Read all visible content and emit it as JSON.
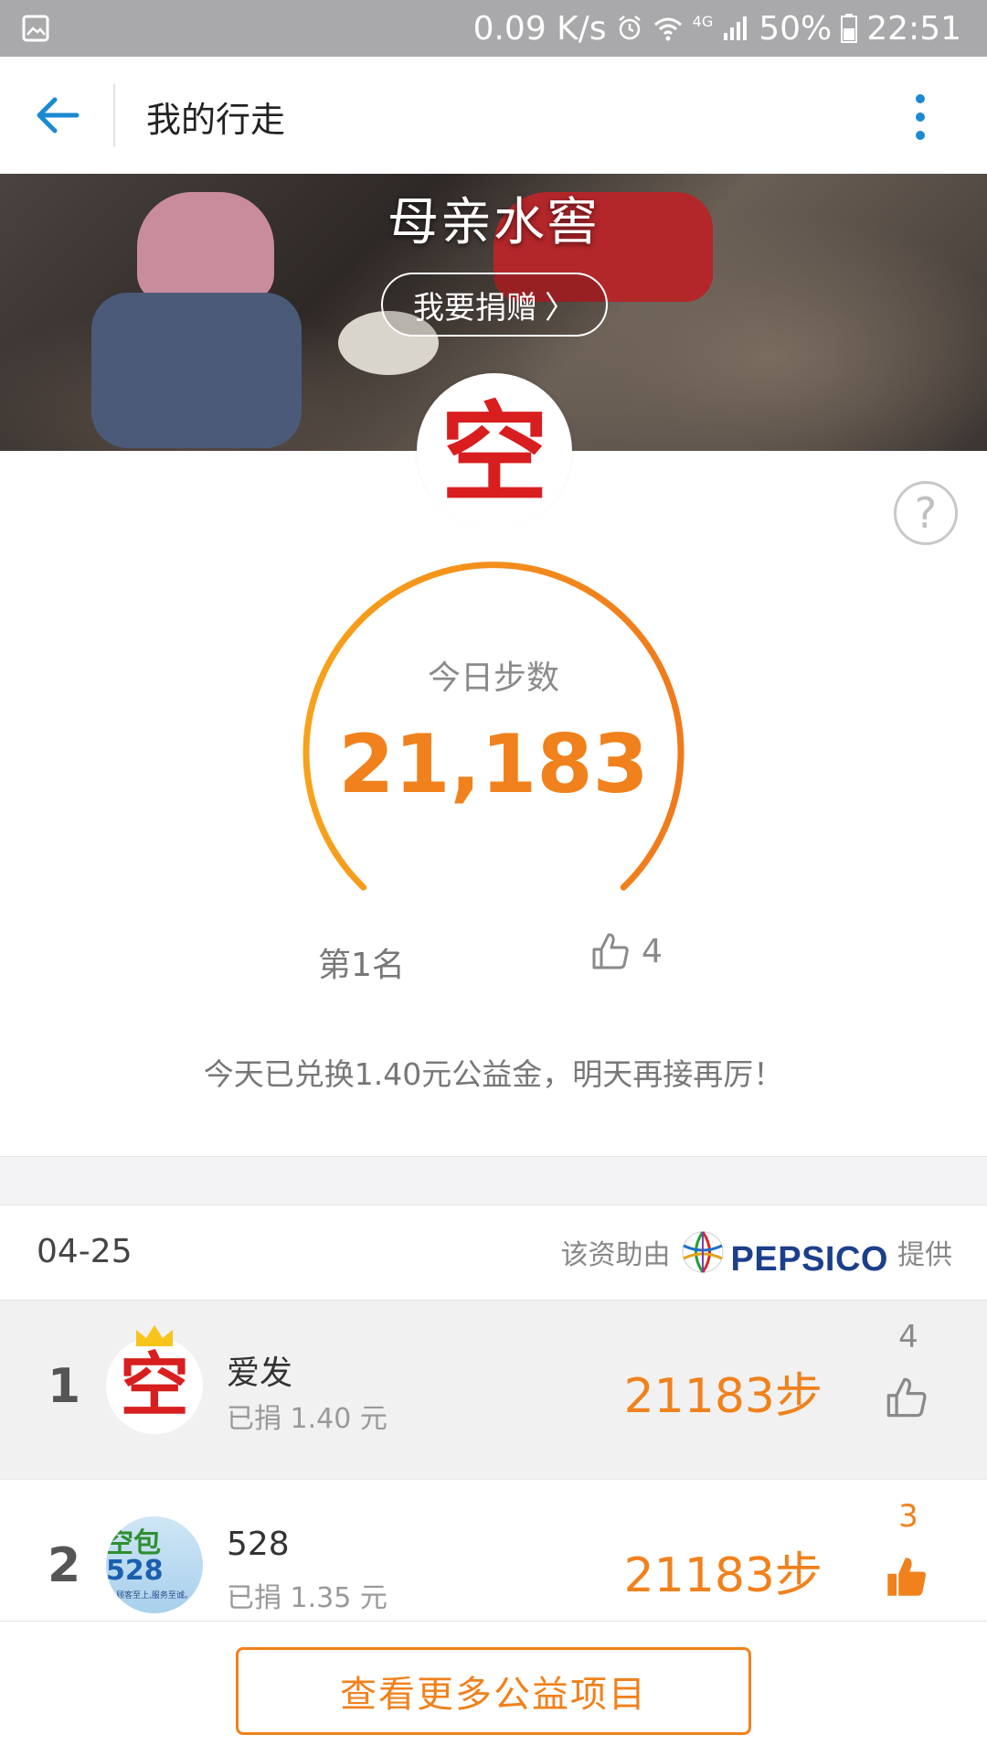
{
  "status_bar": {
    "speed": "0.09 K/s",
    "network_label": "4G",
    "battery": "50%",
    "time": "22:51"
  },
  "app_bar": {
    "title": "我的行走"
  },
  "banner": {
    "title": "母亲水窖",
    "donate_label": "我要捐赠",
    "donate_chevron": "〉"
  },
  "profile": {
    "avatar_char": "空",
    "help_label": "?"
  },
  "gauge": {
    "label": "今日步数",
    "steps": "21,183"
  },
  "stats": {
    "rank": "第1名",
    "likes": "4"
  },
  "note": "今天已兑换1.40元公益金，明天再接再厉！",
  "list_header": {
    "date": "04-25",
    "sponsor_prefix": "该资助由",
    "sponsor_brand": "PEPSICO",
    "sponsor_suffix": "提供"
  },
  "ranking": [
    {
      "rank": "1",
      "avatar_char": "空",
      "name": "爱发",
      "donated": "已捐 1.40 元",
      "steps": "21183步",
      "likes": "4",
      "liked": false
    },
    {
      "rank": "2",
      "avatar_text": "空包",
      "avatar_num": "528",
      "avatar_slogan": "顾客至上,服务至诚。",
      "name": "528",
      "donated": "已捐 1.35 元",
      "steps": "21183步",
      "likes": "3",
      "liked": true
    }
  ],
  "bottom": {
    "more_label": "查看更多公益项目"
  },
  "colors": {
    "accent": "#f0811c",
    "back_arrow": "#1b8ad3",
    "avatar_red": "#d81e1e",
    "status_bar": "#a9a9ab"
  },
  "icons": [
    "gallery-icon",
    "alarm-icon",
    "wifi-icon",
    "signal-icon",
    "battery-icon",
    "back-arrow-icon",
    "more-vertical-icon",
    "help-icon",
    "thumbs-up-icon",
    "crown-icon",
    "pepsi-globe-icon"
  ]
}
